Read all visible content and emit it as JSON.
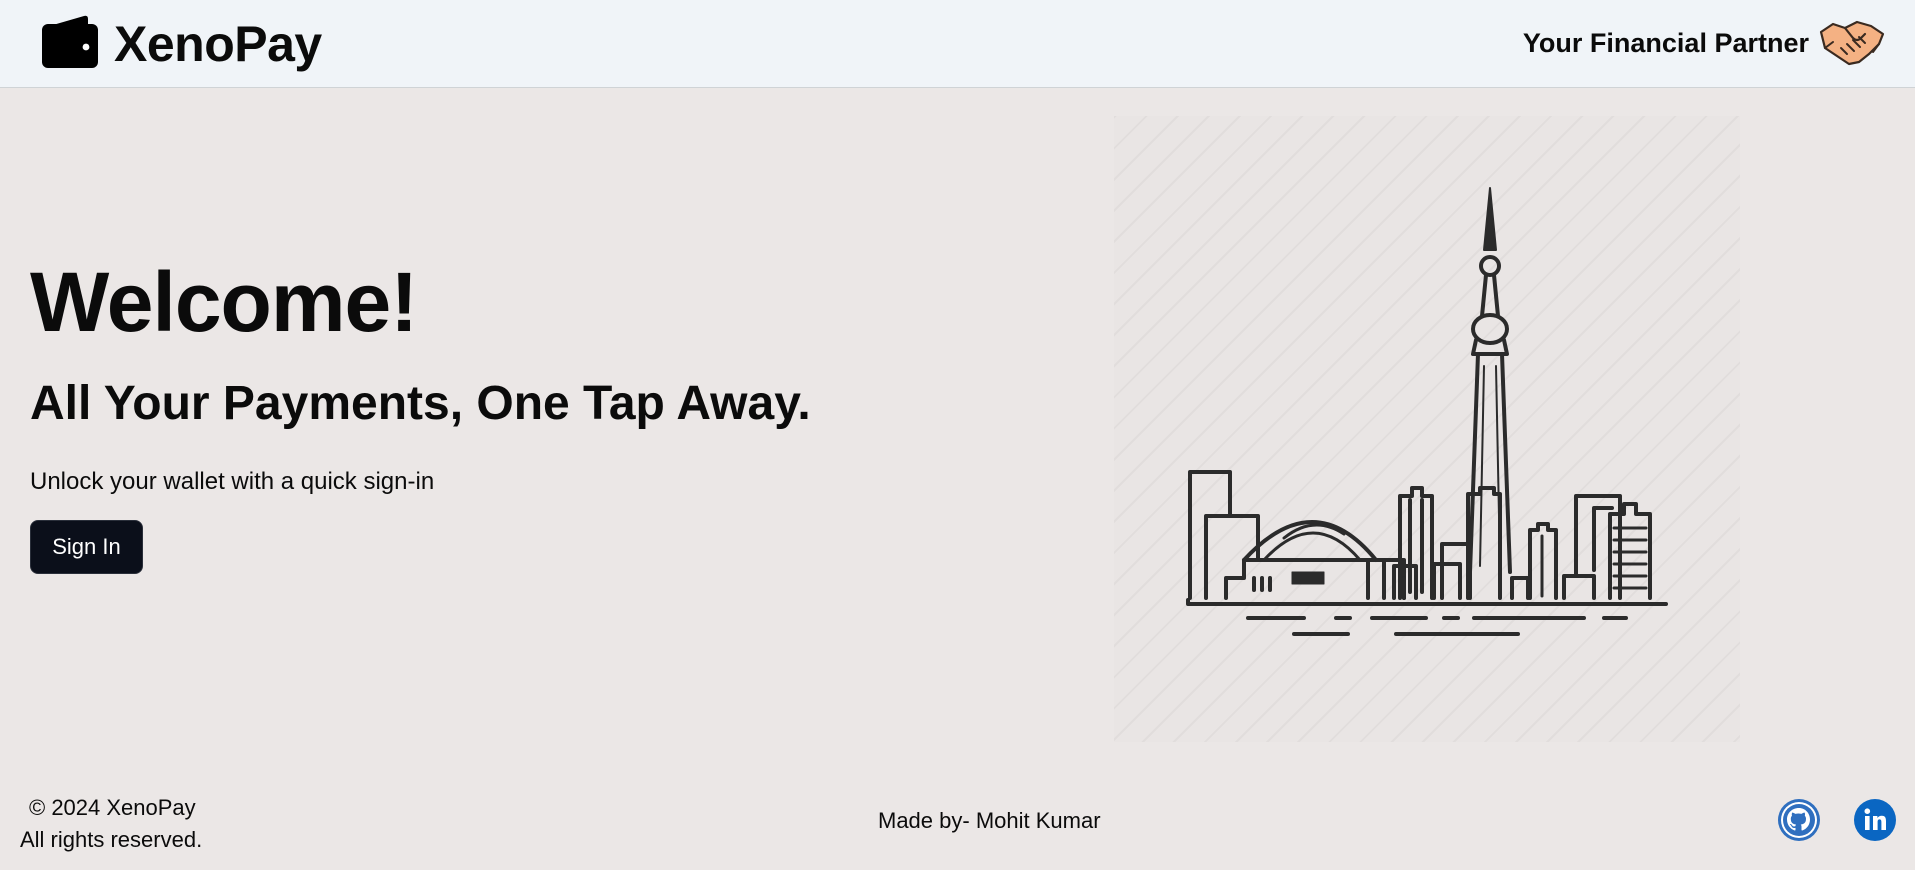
{
  "header": {
    "brand_name": "XenoPay",
    "tagline": "Your Financial Partner",
    "brand_icon": "wallet-icon",
    "tagline_icon": "handshake-icon"
  },
  "hero": {
    "welcome": "Welcome!",
    "subheading": "All Your Payments, One Tap Away.",
    "lead": "Unlock your wallet with a quick sign-in",
    "signin_label": "Sign In",
    "illustration": "toronto-skyline-illustration"
  },
  "footer": {
    "copyright_line1": "© 2024 XenoPay",
    "copyright_line2": "All rights reserved.",
    "credit": "Made by- Mohit Kumar",
    "social_icons": [
      "github-icon",
      "linkedin-icon"
    ]
  },
  "colors": {
    "background": "#ebe7e6",
    "header_background": "#f0f4f8",
    "button_background": "#0b0f1a",
    "github_blue": "#2f6fbf",
    "linkedin_blue": "#0a66c2",
    "handshake_skin": "#f4b183"
  }
}
